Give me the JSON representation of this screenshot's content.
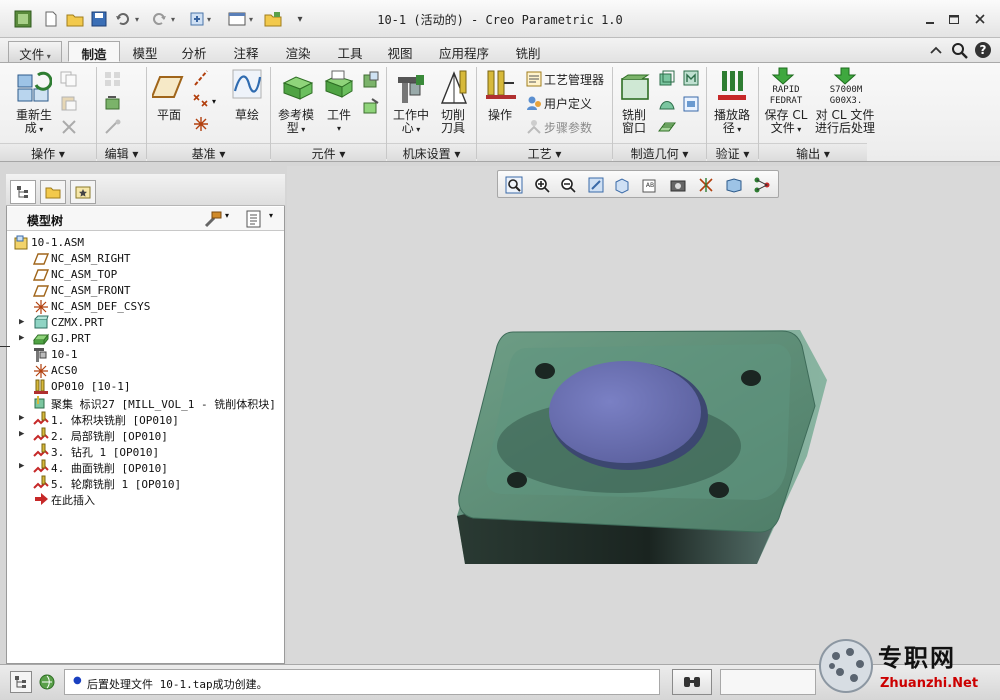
{
  "window": {
    "title": "10-1 (活动的) - Creo Parametric 1.0"
  },
  "menubar": {
    "tabs": [
      {
        "label": "文件",
        "kind": "file"
      },
      {
        "label": "制造",
        "kind": "active"
      },
      {
        "label": "模型"
      },
      {
        "label": "分析"
      },
      {
        "label": "注释"
      },
      {
        "label": "渲染"
      },
      {
        "label": "工具"
      },
      {
        "label": "视图"
      },
      {
        "label": "应用程序"
      },
      {
        "label": "铣削"
      }
    ]
  },
  "ribbon": {
    "groups": {
      "operation": "操作",
      "edit": "编辑",
      "datum": "基准",
      "component": "元件",
      "machine_setup": "机床设置",
      "process": "工艺",
      "mfg_geometry": "制造几何",
      "verify": "验证",
      "output": "输出"
    },
    "buttons": {
      "regenerate_l1": "重新生",
      "regenerate_l2": "成",
      "plane": "平面",
      "sketch": "草绘",
      "ref_model_l1": "参考模",
      "ref_model_l2": "型",
      "workpiece": "工件",
      "work_center_l1": "工作中",
      "work_center_l2": "心",
      "cutting_tool_l1": "切削",
      "cutting_tool_l2": "刀具",
      "operation": "操作",
      "process_manager": "工艺管理器",
      "user_defined": "用户定义",
      "step_params": "步骤参数",
      "mill_window_l1": "铣削",
      "mill_window_l2": "窗口",
      "play_path_l1": "播放路",
      "play_path_l2": "径",
      "save_cl_l1": "保存 CL",
      "save_cl_l2": "文件",
      "post_cl_l1": "对 CL 文件",
      "post_cl_l2": "进行后处理",
      "rapid_l1": "RAPID",
      "rapid_l2": "FEDRAT",
      "s7000_l1": "S7000M",
      "s7000_l2": "G00X3."
    }
  },
  "model_tree": {
    "title": "模型树",
    "items": [
      {
        "text": "10-1.ASM",
        "icon": "assembly-icon",
        "expander": false,
        "indent": 0
      },
      {
        "text": "NC_ASM_RIGHT",
        "icon": "datum-plane-icon",
        "expander": false,
        "indent": 1
      },
      {
        "text": "NC_ASM_TOP",
        "icon": "datum-plane-icon",
        "expander": false,
        "indent": 1
      },
      {
        "text": "NC_ASM_FRONT",
        "icon": "datum-plane-icon",
        "expander": false,
        "indent": 1
      },
      {
        "text": "NC_ASM_DEF_CSYS",
        "icon": "csys-icon",
        "expander": false,
        "indent": 1
      },
      {
        "text": "CZMX.PRT",
        "icon": "part-icon",
        "expander": true,
        "indent": 1
      },
      {
        "text": "GJ.PRT",
        "icon": "workpiece-icon",
        "expander": true,
        "indent": 1
      },
      {
        "text": "10-1",
        "icon": "workcenter-icon",
        "expander": false,
        "indent": 1
      },
      {
        "text": "ACS0",
        "icon": "csys-icon",
        "expander": false,
        "indent": 1
      },
      {
        "text": "OP010 [10-1]",
        "icon": "operation-icon",
        "expander": false,
        "indent": 1
      },
      {
        "text": "聚集 标识27 [MILL_VOL_1 - 铣削体积块]",
        "icon": "mill-volume-icon",
        "expander": false,
        "indent": 1
      },
      {
        "text": "1. 体积块铣削 [OP010]",
        "icon": "sequence-icon",
        "expander": true,
        "indent": 1
      },
      {
        "text": "2. 局部铣削 [OP010]",
        "icon": "sequence-icon",
        "expander": true,
        "indent": 1
      },
      {
        "text": "3. 钻孔 1 [OP010]",
        "icon": "sequence-icon",
        "expander": false,
        "indent": 1
      },
      {
        "text": "4. 曲面铣削 [OP010]",
        "icon": "sequence-icon",
        "expander": true,
        "indent": 1
      },
      {
        "text": "5. 轮廓铣削 1 [OP010]",
        "icon": "sequence-icon",
        "expander": false,
        "indent": 1
      },
      {
        "text": "在此插入",
        "icon": "insert-here-arrow-icon",
        "expander": false,
        "indent": 1
      }
    ]
  },
  "statusbar": {
    "message": "后置处理文件 10-1.tap成功创建。"
  },
  "watermark": {
    "text": "专职网",
    "url": "Zhuanzhi.Net"
  },
  "colors": {
    "model_green": "#4f7c6b",
    "model_top": "#5e8f7a",
    "model_dark": "#1f2a26",
    "boss_blue": "#6a6fb2",
    "viewport_bg": "#d9d9d9"
  }
}
